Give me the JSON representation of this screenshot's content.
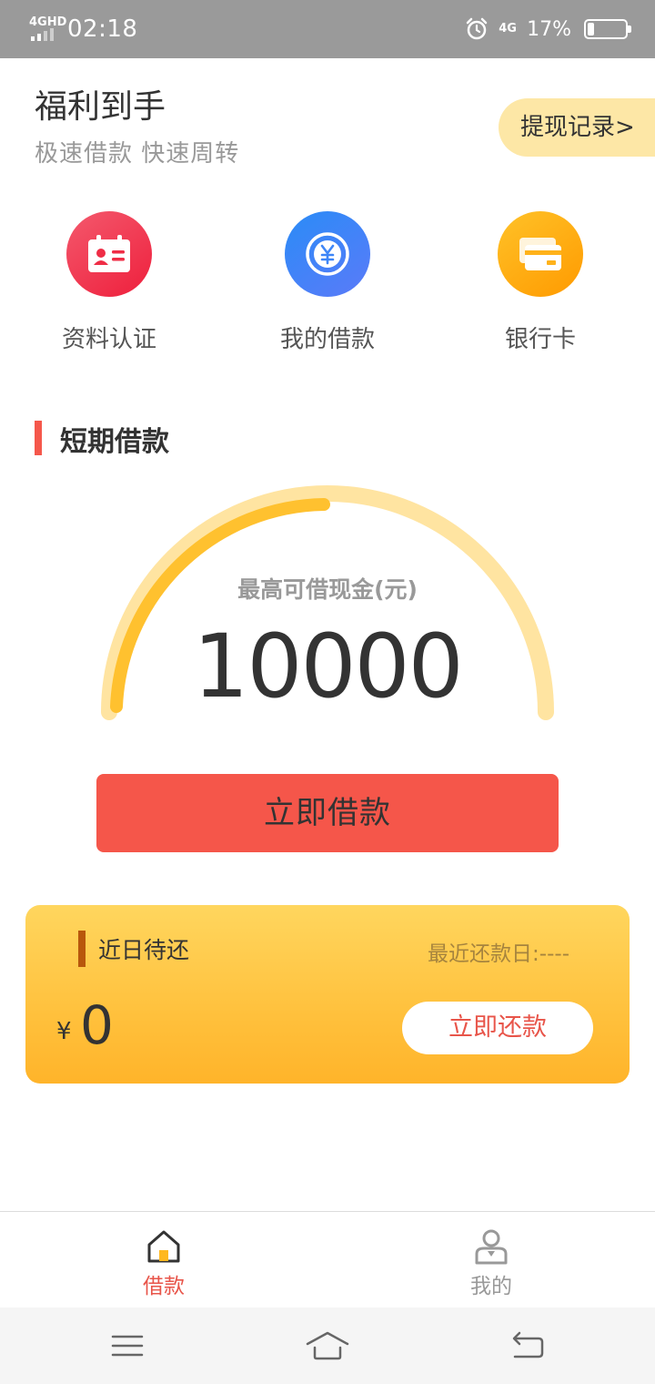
{
  "status_bar": {
    "network": "4GHD",
    "time": "02:18",
    "network_right": "4G",
    "battery": "17%",
    "battery_level": 0.17
  },
  "header": {
    "title": "福利到手",
    "subtitle": "极速借款 快速周转",
    "withdraw_record_label": "提现记录>"
  },
  "quick_entries": [
    {
      "label": "资料认证",
      "icon": "id-card-icon",
      "color": "#ef2d46"
    },
    {
      "label": "我的借款",
      "icon": "yen-coin-icon",
      "color": "#3e86f7"
    },
    {
      "label": "银行卡",
      "icon": "bank-card-icon",
      "color": "#ffad12"
    }
  ],
  "loan": {
    "section_title": "短期借款",
    "caption": "最高可借现金(元)",
    "amount": "10000",
    "borrow_button": "立即借款"
  },
  "repay": {
    "title": "近日待还",
    "recent_date": "最近还款日:----",
    "currency": "¥",
    "amount": "0",
    "repay_button": "立即还款"
  },
  "tabs": [
    {
      "label": "借款",
      "icon": "home-icon",
      "active": true
    },
    {
      "label": "我的",
      "icon": "user-icon",
      "active": false
    }
  ],
  "colors": {
    "accent_red": "#f5564a",
    "gauge_track": "#ffe4a1",
    "gauge_progress": "#ffc12f"
  }
}
